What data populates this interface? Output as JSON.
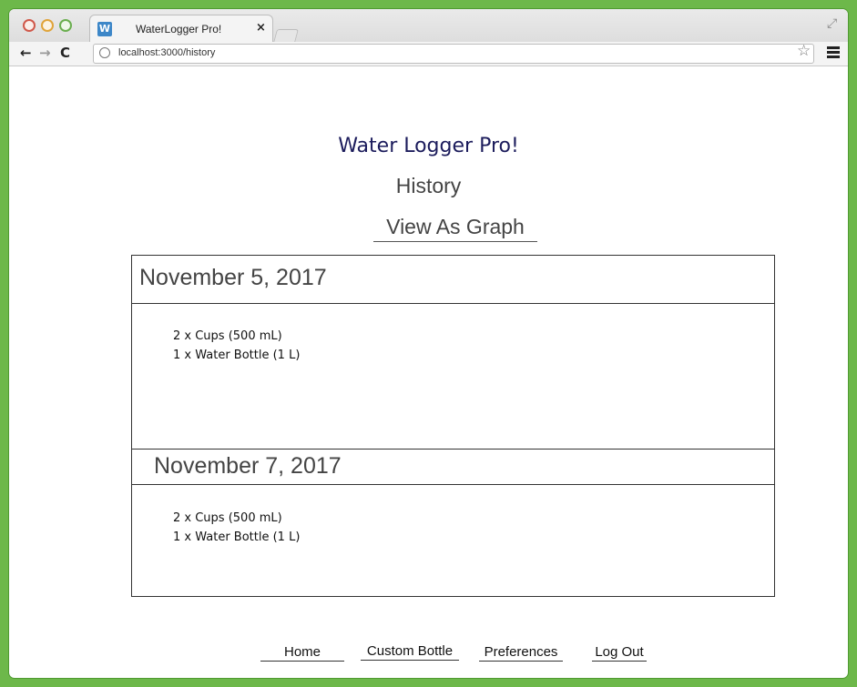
{
  "browser": {
    "tab_title": "WaterLogger Pro!",
    "favicon_letter": "W",
    "tab_close": "×",
    "url": "localhost:3000/history",
    "back_glyph": "←",
    "forward_glyph": "→",
    "reload_glyph": "C",
    "star_glyph": "☆",
    "resize_glyph": "⤢"
  },
  "header": {
    "app_title": "Water Logger Pro!",
    "page_title": "History",
    "view_graph_label": "View As Graph"
  },
  "history": [
    {
      "date": "November 5, 2017",
      "entries": [
        "2 x Cups (500 mL)",
        "1 x Water Bottle (1 L)"
      ]
    },
    {
      "date": "November 7, 2017",
      "entries": [
        "2 x Cups (500 mL)",
        "1 x Water Bottle (1 L)"
      ]
    }
  ],
  "footer": {
    "home": "Home",
    "custom_bottle": "Custom Bottle",
    "preferences": "Preferences",
    "log_out": "Log Out"
  },
  "colors": {
    "frame_green": "#6db84a",
    "app_title_color": "#1c1c5c"
  }
}
